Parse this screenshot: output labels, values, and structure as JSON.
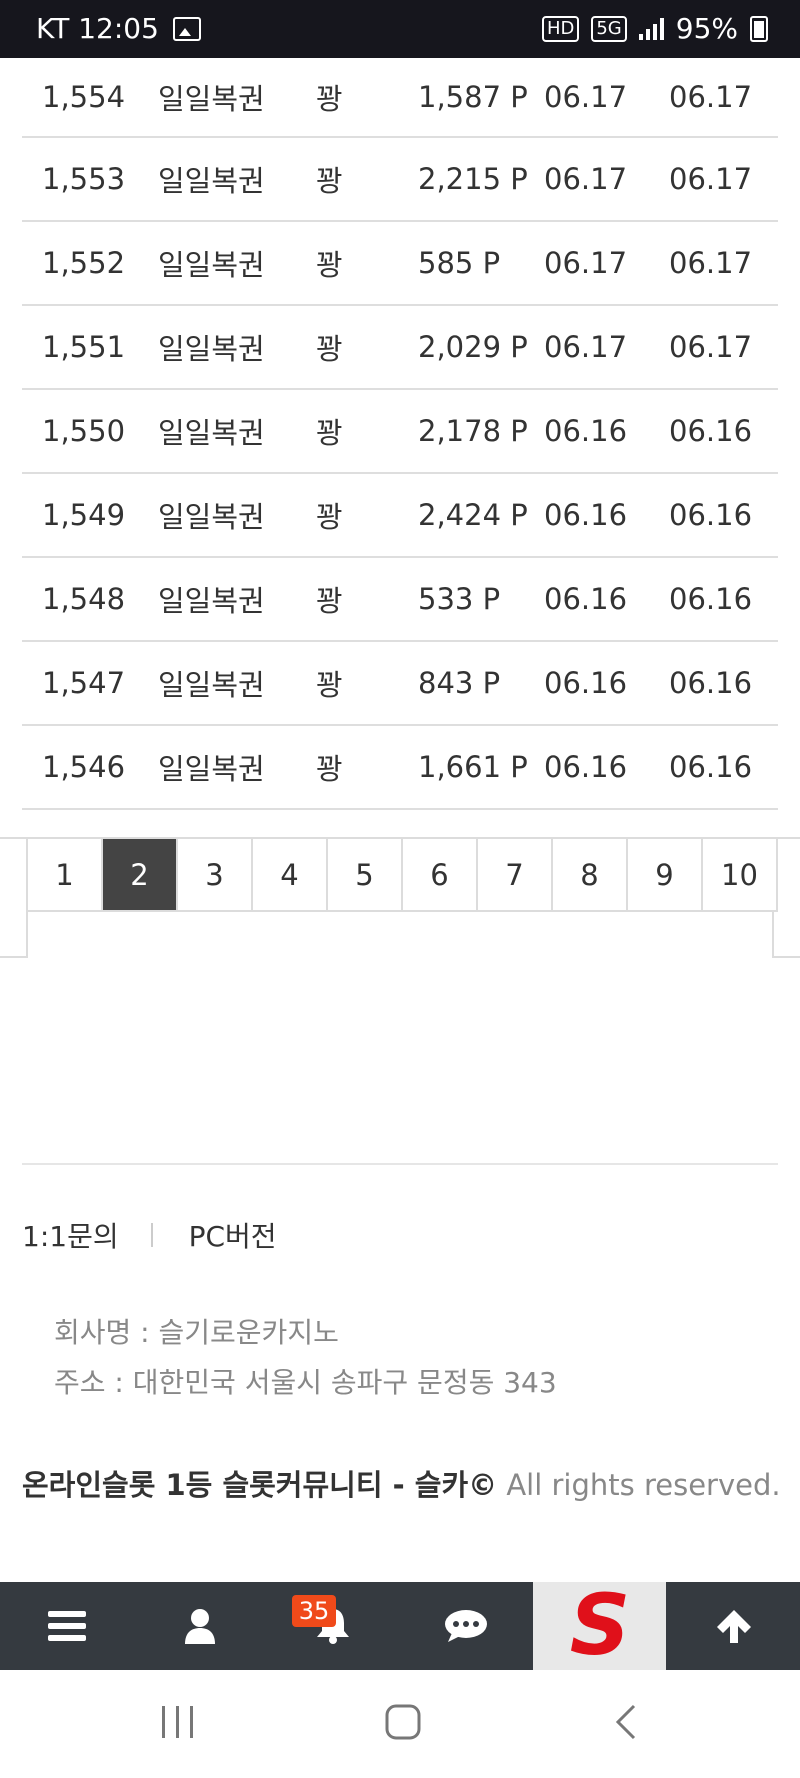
{
  "status_bar": {
    "carrier_time": "KT 12:05",
    "network": "5G",
    "hd": "HD",
    "battery": "95%"
  },
  "rows": [
    {
      "num": "1,554",
      "type": "일일복권",
      "author": "꽝",
      "points": "1,587 P",
      "date1": "06.17",
      "date2": "06.17"
    },
    {
      "num": "1,553",
      "type": "일일복권",
      "author": "꽝",
      "points": "2,215 P",
      "date1": "06.17",
      "date2": "06.17"
    },
    {
      "num": "1,552",
      "type": "일일복권",
      "author": "꽝",
      "points": "585 P",
      "date1": "06.17",
      "date2": "06.17"
    },
    {
      "num": "1,551",
      "type": "일일복권",
      "author": "꽝",
      "points": "2,029 P",
      "date1": "06.17",
      "date2": "06.17"
    },
    {
      "num": "1,550",
      "type": "일일복권",
      "author": "꽝",
      "points": "2,178 P",
      "date1": "06.16",
      "date2": "06.16"
    },
    {
      "num": "1,549",
      "type": "일일복권",
      "author": "꽝",
      "points": "2,424 P",
      "date1": "06.16",
      "date2": "06.16"
    },
    {
      "num": "1,548",
      "type": "일일복권",
      "author": "꽝",
      "points": "533 P",
      "date1": "06.16",
      "date2": "06.16"
    },
    {
      "num": "1,547",
      "type": "일일복권",
      "author": "꽝",
      "points": "843 P",
      "date1": "06.16",
      "date2": "06.16"
    },
    {
      "num": "1,546",
      "type": "일일복권",
      "author": "꽝",
      "points": "1,661 P",
      "date1": "06.16",
      "date2": "06.16"
    }
  ],
  "pagination": {
    "pages": [
      "1",
      "2",
      "3",
      "4",
      "5",
      "6",
      "7",
      "8",
      "9",
      "10"
    ],
    "active": "2"
  },
  "footer": {
    "inquiry_link": "1:1문의",
    "pc_link": "PC버전",
    "company_name": "회사명 : 슬기로운카지노",
    "address": "주소 : 대한민국 서울시 송파구 문정동 343",
    "copyright_bold": "온라인슬롯 1등 슬롯커뮤니티 - 슬카©",
    "copyright_rest": " All rights reserved."
  },
  "bottom_nav": {
    "notification_count": "35",
    "logo_letter": "S",
    "items": [
      "menu-icon",
      "user-icon",
      "bell-icon",
      "chat-icon",
      "logo",
      "arrow-up-icon"
    ]
  },
  "colors": {
    "nav_bg": "#353a40",
    "active_page_bg": "#444444",
    "badge": "#f04a1a",
    "logo_red": "#e0101a"
  }
}
